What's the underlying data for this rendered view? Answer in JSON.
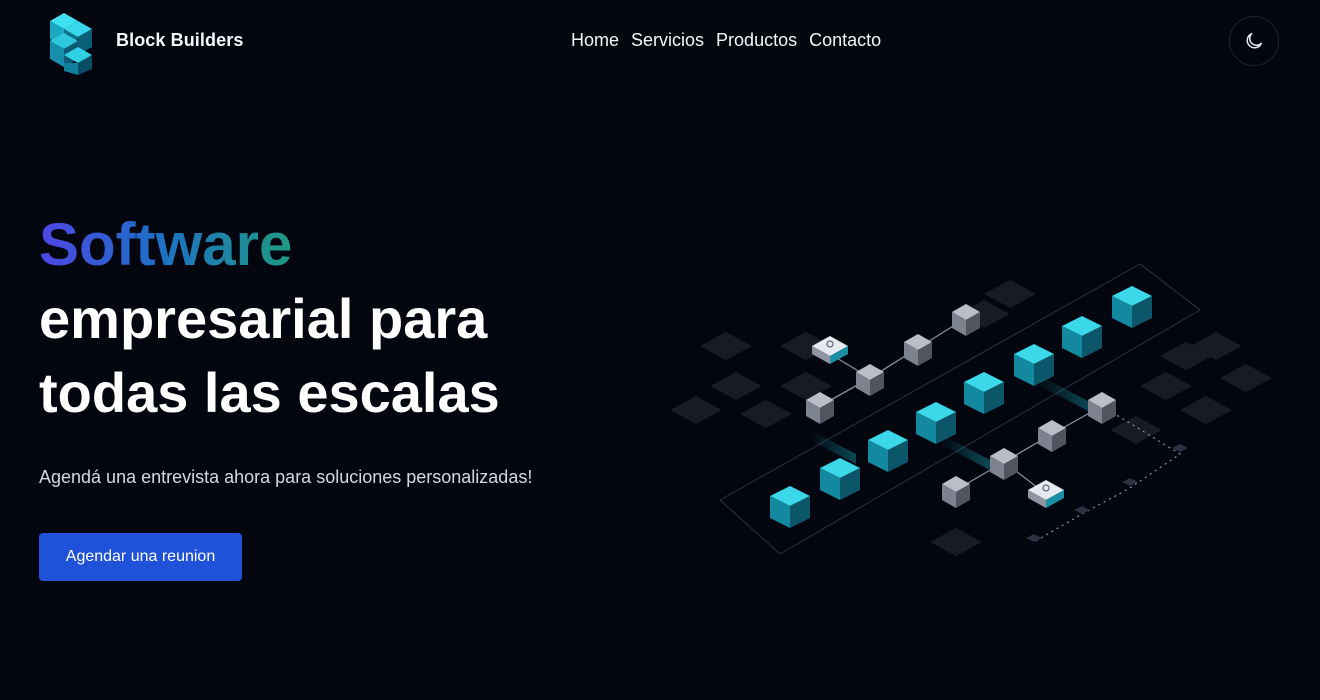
{
  "header": {
    "brand": "Block Builders",
    "logo_icon": "stacked-blocks-logo-icon",
    "nav": [
      "Home",
      "Servicios",
      "Productos",
      "Contacto"
    ],
    "theme_toggle_icon": "moon-icon"
  },
  "hero": {
    "highlight": "Software",
    "title_line1": "empresarial para",
    "title_line2": "todas las escalas",
    "subtitle": "Agendá una entrevista ahora para soluciones personalizadas!",
    "cta_label": "Agendar una reunion",
    "illustration_icon": "isometric-blocks-network-illustration"
  },
  "colors": {
    "background": "#03060f",
    "accent_button": "#1f52d8",
    "gradient_start": "#4f46e5",
    "gradient_end": "#1f9a83",
    "cube_teal": "#1fc6d6"
  }
}
